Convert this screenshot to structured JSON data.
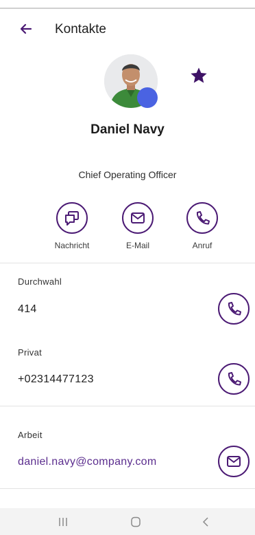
{
  "header": {
    "title": "Kontakte",
    "back_icon": "arrow-left-icon"
  },
  "contact": {
    "name": "Daniel Navy",
    "role": "Chief Operating Officer",
    "favorite": true,
    "status_color": "#4a63e2"
  },
  "actions": [
    {
      "label": "Nachricht",
      "icon": "message-icon"
    },
    {
      "label": "E-Mail",
      "icon": "mail-icon"
    },
    {
      "label": "Anruf",
      "icon": "phone-icon"
    }
  ],
  "fields": {
    "extension": {
      "label": "Durchwahl",
      "value": "414",
      "icon": "phone-icon"
    },
    "private": {
      "label": "Privat",
      "value": "+02314477123",
      "icon": "phone-icon"
    },
    "work": {
      "label": "Arbeit",
      "value": "daniel.navy@company.com",
      "icon": "mail-icon"
    }
  },
  "navbar": {
    "recent_icon": "recent-apps-icon",
    "home_icon": "home-icon",
    "back_icon": "back-chevron-icon"
  },
  "colors": {
    "accent": "#4b1a74",
    "link": "#5b2d8e",
    "status": "#4a63e2"
  }
}
